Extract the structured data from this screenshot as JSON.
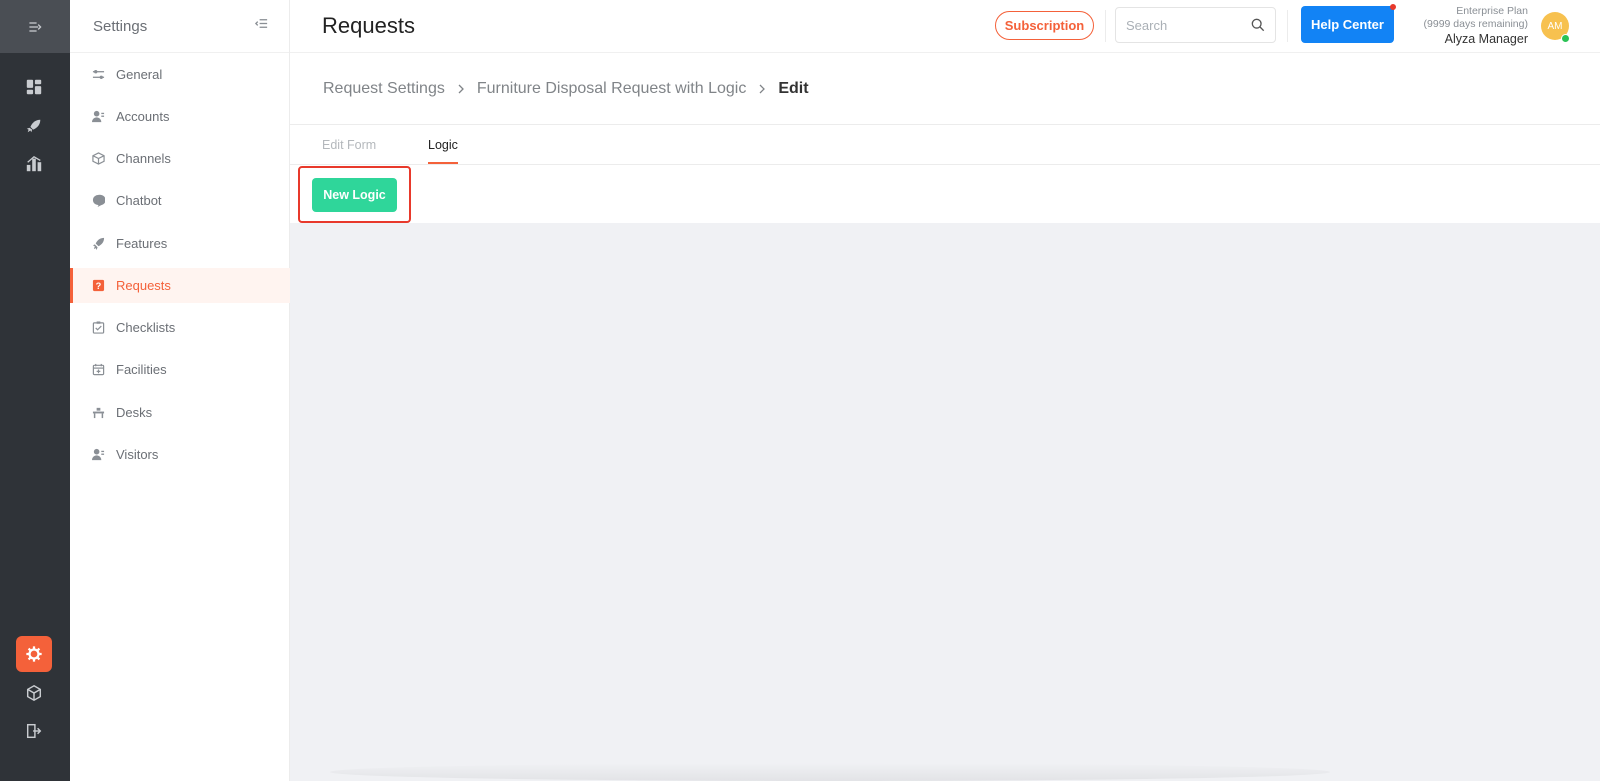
{
  "sidebar_rail": {
    "icons": [
      "collapse-menu-icon",
      "dashboard-icon",
      "rocket-icon",
      "analytics-icon",
      "settings-icon",
      "box-icon",
      "logout-icon"
    ]
  },
  "settings_panel": {
    "title": "Settings",
    "items": [
      {
        "label": "General",
        "icon": "sliders-icon"
      },
      {
        "label": "Accounts",
        "icon": "user-icon"
      },
      {
        "label": "Channels",
        "icon": "cube-icon"
      },
      {
        "label": "Chatbot",
        "icon": "chat-bubble-icon"
      },
      {
        "label": "Features",
        "icon": "rocket-icon"
      },
      {
        "label": "Requests",
        "icon": "question-icon",
        "active": true
      },
      {
        "label": "Checklists",
        "icon": "checklist-icon"
      },
      {
        "label": "Facilities",
        "icon": "calendar-plus-icon"
      },
      {
        "label": "Desks",
        "icon": "desk-icon"
      },
      {
        "label": "Visitors",
        "icon": "visitor-icon"
      }
    ]
  },
  "header": {
    "title": "Requests",
    "subscription_label": "Subscription",
    "search_placeholder": "Search",
    "help_label": "Help Center",
    "plan_name": "Enterprise Plan",
    "plan_remaining": "(9999 days remaining)",
    "user_name": "Alyza Manager",
    "avatar_initials": "AM"
  },
  "breadcrumb": {
    "items": [
      "Request Settings",
      "Furniture Disposal Request with Logic",
      "Edit"
    ]
  },
  "tabs": {
    "edit_form": "Edit Form",
    "logic": "Logic",
    "active": "Logic"
  },
  "actions": {
    "new_logic_label": "New Logic"
  },
  "colors": {
    "accent": "#f4613a",
    "rail_bg": "#2f3338",
    "help_blue": "#1283f5",
    "new_logic_green": "#2fd69a",
    "highlight_red": "#e8392b",
    "content_bg": "#f0f1f4"
  }
}
